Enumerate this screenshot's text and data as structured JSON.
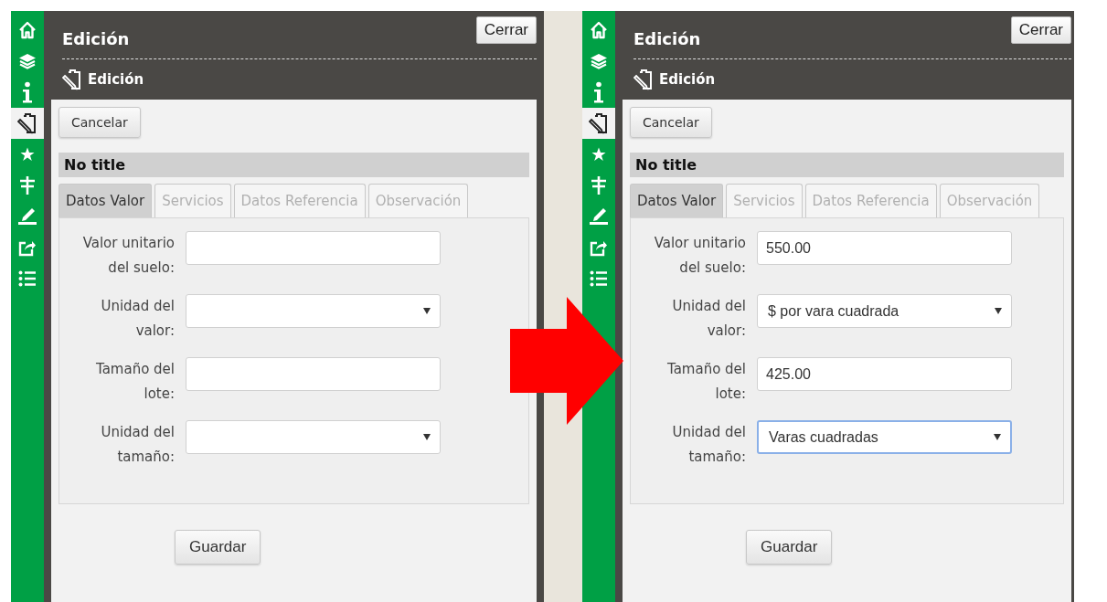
{
  "panels": [
    {
      "sidebar": {
        "items": [
          {
            "kind": "home",
            "selected": false
          },
          {
            "kind": "layers",
            "selected": false
          },
          {
            "kind": "info",
            "selected": false
          },
          {
            "kind": "edit",
            "selected": true
          },
          {
            "kind": "star",
            "selected": false
          },
          {
            "kind": "signpost",
            "selected": false
          },
          {
            "kind": "measure",
            "selected": false
          },
          {
            "kind": "share",
            "selected": false
          },
          {
            "kind": "list",
            "selected": false
          }
        ]
      },
      "title": "Edición",
      "close_button": "Cerrar",
      "section_title": "Edición",
      "cancel_button": "Cancelar",
      "record_title": "No title",
      "tabs": [
        {
          "label": "Datos Valor",
          "selected": true
        },
        {
          "label": "Servicios",
          "selected": false
        },
        {
          "label": "Datos Referencia",
          "selected": false
        },
        {
          "label": "Observación",
          "selected": false
        }
      ],
      "fields": [
        {
          "label": "Valor unitario del suelo:",
          "kind": "text",
          "focused": false
        },
        {
          "label": "Unidad del valor:",
          "kind": "select",
          "focused": false
        },
        {
          "label": "Tamaño del lote:",
          "kind": "text",
          "focused": false
        },
        {
          "label": "Unidad del tamaño:",
          "kind": "select",
          "focused": false
        }
      ],
      "save_button": "Guardar"
    },
    {
      "sidebar": {
        "items": [
          {
            "kind": "home",
            "selected": false
          },
          {
            "kind": "layers",
            "selected": false
          },
          {
            "kind": "info",
            "selected": false
          },
          {
            "kind": "edit",
            "selected": true
          },
          {
            "kind": "star",
            "selected": false
          },
          {
            "kind": "signpost",
            "selected": false
          },
          {
            "kind": "measure",
            "selected": false
          },
          {
            "kind": "share",
            "selected": false
          },
          {
            "kind": "list",
            "selected": false
          }
        ]
      },
      "title": "Edición",
      "close_button": "Cerrar",
      "section_title": "Edición",
      "cancel_button": "Cancelar",
      "record_title": "No title",
      "tabs": [
        {
          "label": "Datos Valor",
          "selected": true
        },
        {
          "label": "Servicios",
          "selected": false
        },
        {
          "label": "Datos Referencia",
          "selected": false
        },
        {
          "label": "Observación",
          "selected": false
        }
      ],
      "fields": [
        {
          "label": "Valor unitario del suelo:",
          "kind": "text",
          "value": "550.00",
          "focused": false
        },
        {
          "label": "Unidad del valor:",
          "kind": "select",
          "value": "$ por vara cuadrada",
          "focused": false
        },
        {
          "label": "Tamaño del lote:",
          "kind": "text",
          "value": "425.00",
          "focused": false
        },
        {
          "label": "Unidad del tamaño:",
          "kind": "select",
          "value": "Varas cuadradas",
          "focused": true
        }
      ],
      "save_button": "Guardar"
    }
  ]
}
